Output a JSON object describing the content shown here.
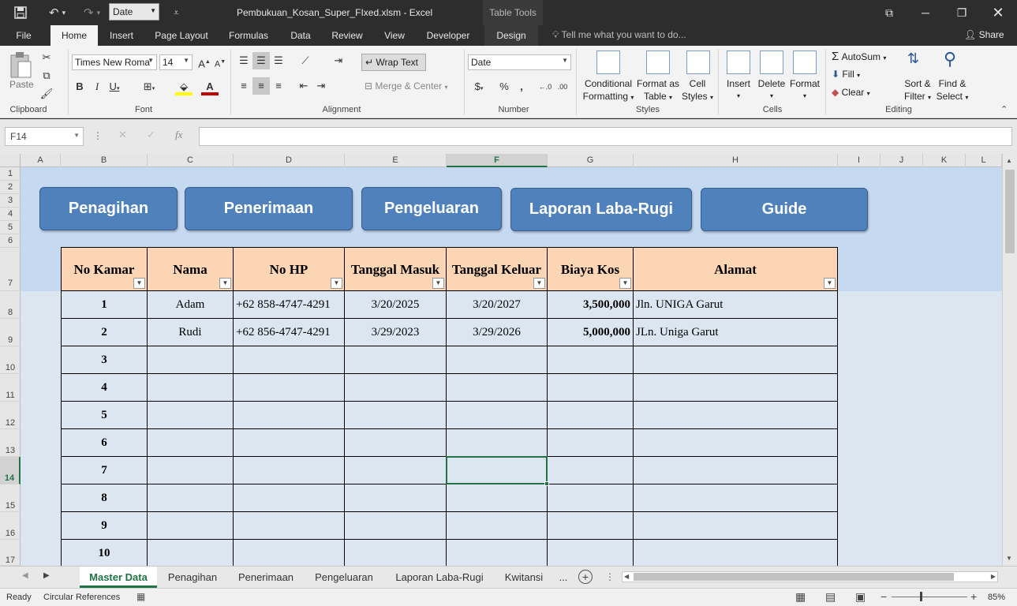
{
  "titlebar": {
    "format_box": "Date",
    "document_title": "Pembukuan_Kosan_Super_FIxed.xlsm - Excel",
    "context_title": "Table Tools"
  },
  "tabs": [
    "File",
    "Home",
    "Insert",
    "Page Layout",
    "Formulas",
    "Data",
    "Review",
    "View",
    "Developer",
    "Design"
  ],
  "tell_me": "Tell me what you want to do...",
  "share": "Share",
  "ribbon": {
    "clipboard": {
      "paste": "Paste",
      "label": "Clipboard"
    },
    "font": {
      "name": "Times New Roma",
      "size": "14",
      "label": "Font"
    },
    "alignment": {
      "wrap_text": "Wrap Text",
      "merge_center": "Merge & Center",
      "label": "Alignment"
    },
    "number": {
      "format": "Date",
      "label": "Number"
    },
    "styles": {
      "conditional": [
        "Conditional",
        "Formatting"
      ],
      "format_as": [
        "Format as",
        "Table"
      ],
      "cell_styles": [
        "Cell",
        "Styles"
      ],
      "label": "Styles"
    },
    "cells": {
      "insert": "Insert",
      "delete": "Delete",
      "format": "Format",
      "label": "Cells"
    },
    "editing": {
      "autosum": "AutoSum",
      "fill": "Fill",
      "clear": "Clear",
      "sort": [
        "Sort &",
        "Filter"
      ],
      "find": [
        "Find &",
        "Select"
      ],
      "label": "Editing"
    }
  },
  "name_box": "F14",
  "columns": [
    "A",
    "B",
    "C",
    "D",
    "E",
    "F",
    "G",
    "H",
    "I",
    "J",
    "K",
    "L"
  ],
  "rows": [
    "1",
    "2",
    "3",
    "4",
    "5",
    "6",
    "7",
    "8",
    "9",
    "10",
    "11",
    "12",
    "13",
    "14",
    "15",
    "16",
    "17"
  ],
  "nav_buttons": [
    "Penagihan",
    "Penerimaan",
    "Pengeluaran",
    "Laporan Laba-Rugi",
    "Guide"
  ],
  "table": {
    "headers": [
      "No Kamar",
      "Nama",
      "No HP",
      "Tanggal Masuk",
      "Tanggal Keluar",
      "Biaya Kos",
      "Alamat"
    ],
    "rows": [
      [
        "1",
        "Adam",
        "+62 858-4747-4291",
        "3/20/2025",
        "3/20/2027",
        "3,500,000",
        "Jln. UNIGA Garut"
      ],
      [
        "2",
        "Rudi",
        "+62 856-4747-4291",
        "3/29/2023",
        "3/29/2026",
        "5,000,000",
        "JLn. Uniga Garut"
      ],
      [
        "3",
        "",
        "",
        "",
        "",
        "",
        ""
      ],
      [
        "4",
        "",
        "",
        "",
        "",
        "",
        ""
      ],
      [
        "5",
        "",
        "",
        "",
        "",
        "",
        ""
      ],
      [
        "6",
        "",
        "",
        "",
        "",
        "",
        ""
      ],
      [
        "7",
        "",
        "",
        "",
        "",
        "",
        ""
      ],
      [
        "8",
        "",
        "",
        "",
        "",
        "",
        ""
      ],
      [
        "9",
        "",
        "",
        "",
        "",
        "",
        ""
      ],
      [
        "10",
        "",
        "",
        "",
        "",
        "",
        ""
      ]
    ]
  },
  "sheet_tabs": [
    "Master Data",
    "Penagihan",
    "Penerimaan",
    "Pengeluaran",
    "Laporan Laba-Rugi",
    "Kwitansi",
    "..."
  ],
  "status": {
    "ready": "Ready",
    "circular": "Circular References",
    "zoom": "85%"
  },
  "colors": {
    "excel_green": "#217346",
    "button_blue": "#4f81bd",
    "header_peach": "#fcd5b4",
    "banner_blue": "#c5d9f1",
    "row_blue": "#dce6f1"
  }
}
